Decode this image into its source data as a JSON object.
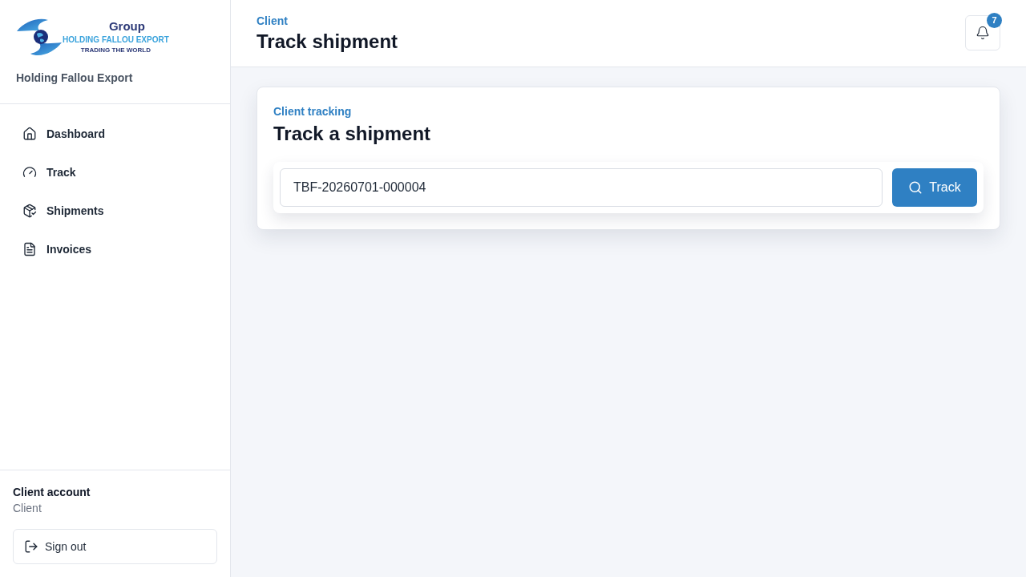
{
  "sidebar": {
    "logo": {
      "word": "Group",
      "name": "HOLDING FALLOU EXPORT",
      "tagline": "TRADING THE WORLD"
    },
    "company": "Holding Fallou Export",
    "nav": [
      {
        "label": "Dashboard",
        "kind": "home",
        "selected": false
      },
      {
        "label": "Track",
        "kind": "gauge",
        "selected": false
      },
      {
        "label": "Shipments",
        "kind": "package",
        "selected": false
      },
      {
        "label": "Invoices",
        "kind": "document",
        "selected": false
      }
    ],
    "account": {
      "name": "Client account",
      "role": "Client"
    },
    "sign_out": "Sign out"
  },
  "header": {
    "eyebrow": "Client",
    "title": "Track shipment",
    "notifications": {
      "count": "7"
    }
  },
  "card": {
    "eyebrow": "Client tracking",
    "title": "Track a shipment",
    "search": {
      "value": "TBF-20260701-000004"
    },
    "button": "Track"
  }
}
